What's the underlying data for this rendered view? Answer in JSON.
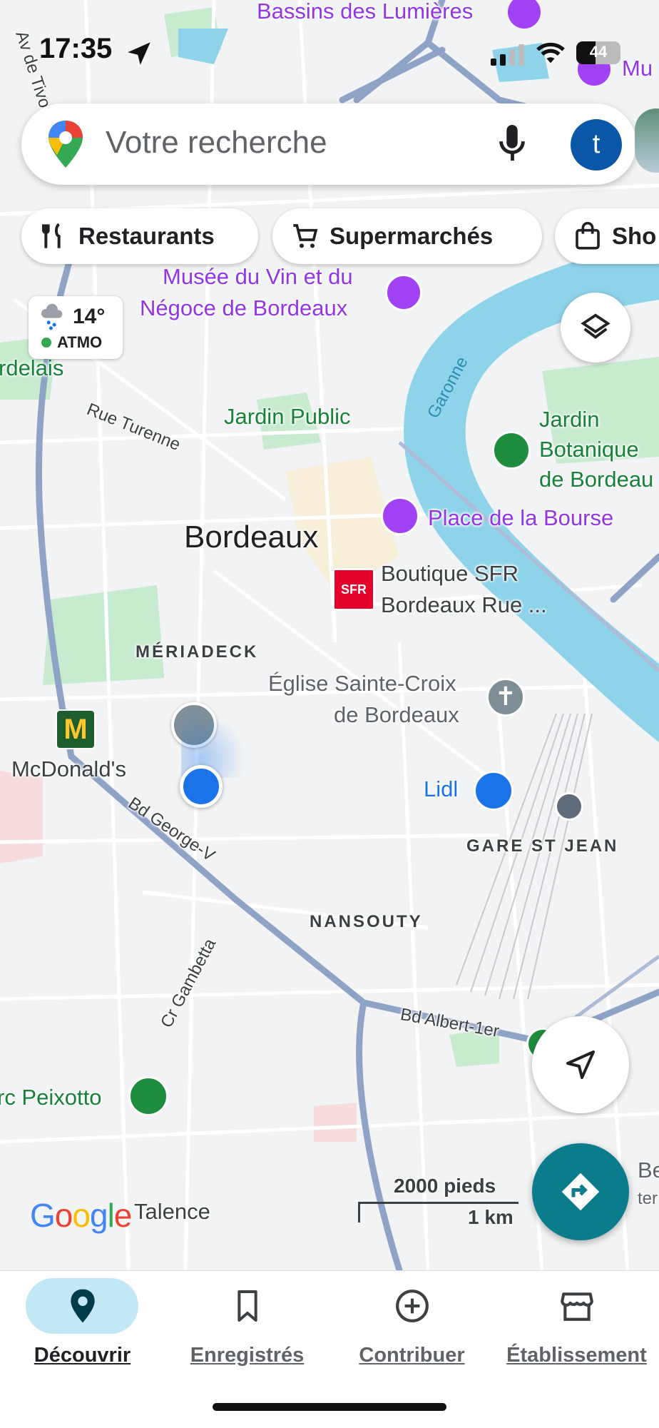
{
  "status_bar": {
    "time": "17:35",
    "battery": "44"
  },
  "search": {
    "placeholder": "Votre recherche",
    "avatar_letter": "t"
  },
  "chips": [
    {
      "label": "Restaurants",
      "icon": "fork-knife-icon"
    },
    {
      "label": "Supermarchés",
      "icon": "cart-icon"
    },
    {
      "label": "Sho",
      "icon": "shopping-bag-icon"
    }
  ],
  "weather": {
    "temp": "14°",
    "aqi": "ATMO"
  },
  "map_labels": {
    "bassins": "Bassins des Lumières",
    "musee_partial": "Mu",
    "musee_vin_1": "Musée du Vin et du",
    "musee_vin_2": "Négoce de Bordeaux",
    "rdelais": "rdelais",
    "rue_turenne": "Rue Turenne",
    "jardin_public": "Jardin Public",
    "garonne": "Garonne",
    "jardin_bot_1": "Jardin",
    "jardin_bot_2": "Botanique",
    "jardin_bot_3": "de Bordeau",
    "bordeaux": "Bordeaux",
    "place_bourse": "Place de la Bourse",
    "sfr_badge": "SFR",
    "sfr_1": "Boutique SFR",
    "sfr_2": "Bordeaux Rue ...",
    "meriadeck": "MÉRIADECK",
    "eglise_1": "Église Sainte-Croix",
    "eglise_2": "de Bordeaux",
    "mcdonalds": "McDonald's",
    "lidl": "Lidl",
    "gare": "GARE ST JEAN",
    "bd_george": "Bd George-V",
    "nansouty": "NANSOUTY",
    "cr_gambetta": "Cr Gambetta",
    "bd_albert": "Bd Albert-1er",
    "peixotto": "rc Peixotto",
    "talence": "Talence",
    "be_partial": "Be",
    "ter_partial": "ter",
    "av_partial": "Av de Tivo"
  },
  "scale": {
    "feet": "2000 pieds",
    "km": "1 km"
  },
  "google_logo": "Google",
  "nav": [
    {
      "label": "Découvrir",
      "active": true
    },
    {
      "label": "Enregistrés",
      "active": false
    },
    {
      "label": "Contribuer",
      "active": false
    },
    {
      "label": "Établissement",
      "active": false
    }
  ],
  "colors": {
    "water": "#8ed3ea",
    "park": "#bfe8c8",
    "road_major": "#8fa3c7",
    "accent": "#0b7c8c",
    "location_blue": "#1a73e8"
  }
}
